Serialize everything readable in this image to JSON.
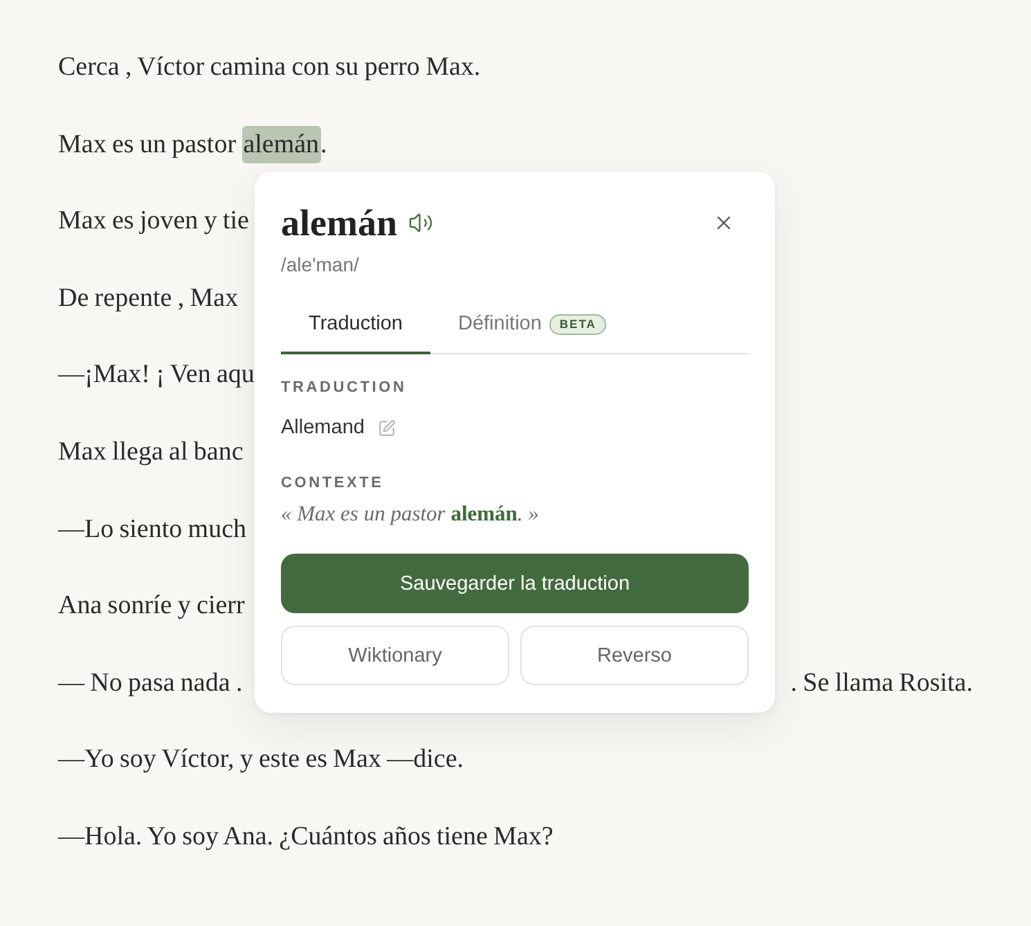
{
  "reader": {
    "paragraphs": [
      {
        "segments": [
          {
            "text": "Cerca , Víctor camina con su perro Max.",
            "highlighted": false
          }
        ]
      },
      {
        "segments": [
          {
            "text": "Max es un pastor ",
            "highlighted": false
          },
          {
            "text": "alemán",
            "highlighted": true
          },
          {
            "text": ".",
            "highlighted": false
          }
        ]
      },
      {
        "segments": [
          {
            "text": "Max es joven y tie",
            "highlighted": false
          }
        ]
      },
      {
        "segments": [
          {
            "text": "De repente , Max",
            "highlighted": false
          }
        ]
      },
      {
        "segments": [
          {
            "text": "—¡Max! ¡ Ven aqu",
            "highlighted": false
          }
        ]
      },
      {
        "segments": [
          {
            "text": "Max llega al banc",
            "highlighted": false
          }
        ]
      },
      {
        "segments": [
          {
            "text": "—Lo siento much",
            "highlighted": false
          }
        ]
      },
      {
        "segments": [
          {
            "text": "Ana sonríe y cierr",
            "highlighted": false
          }
        ]
      },
      {
        "segments": [
          {
            "text": "— No pasa nada .",
            "highlighted": false
          }
        ],
        "continuation": ". Se llama Rosita."
      },
      {
        "segments": [
          {
            "text": "—Yo soy Víctor, y este es Max —dice.",
            "highlighted": false
          }
        ]
      },
      {
        "segments": [
          {
            "text": "—Hola. Yo soy Ana. ¿Cuántos años tiene Max?",
            "highlighted": false
          }
        ]
      }
    ]
  },
  "popup": {
    "word": "alemán",
    "phonetic": "/ale'man/",
    "tabs": [
      {
        "label": "Traduction",
        "selected": true
      },
      {
        "label": "Définition",
        "selected": false,
        "badge": "BETA"
      }
    ],
    "sections": [
      {
        "kind": "translation",
        "label": "TRADUCTION",
        "value": "Allemand"
      },
      {
        "kind": "context",
        "label": "CONTEXTE",
        "value": "« Max es un pastor **alemán**. »"
      }
    ],
    "primary_button": "Sauvegarder la traduction",
    "secondary_buttons": [
      "Wiktionary",
      "Reverso"
    ]
  }
}
